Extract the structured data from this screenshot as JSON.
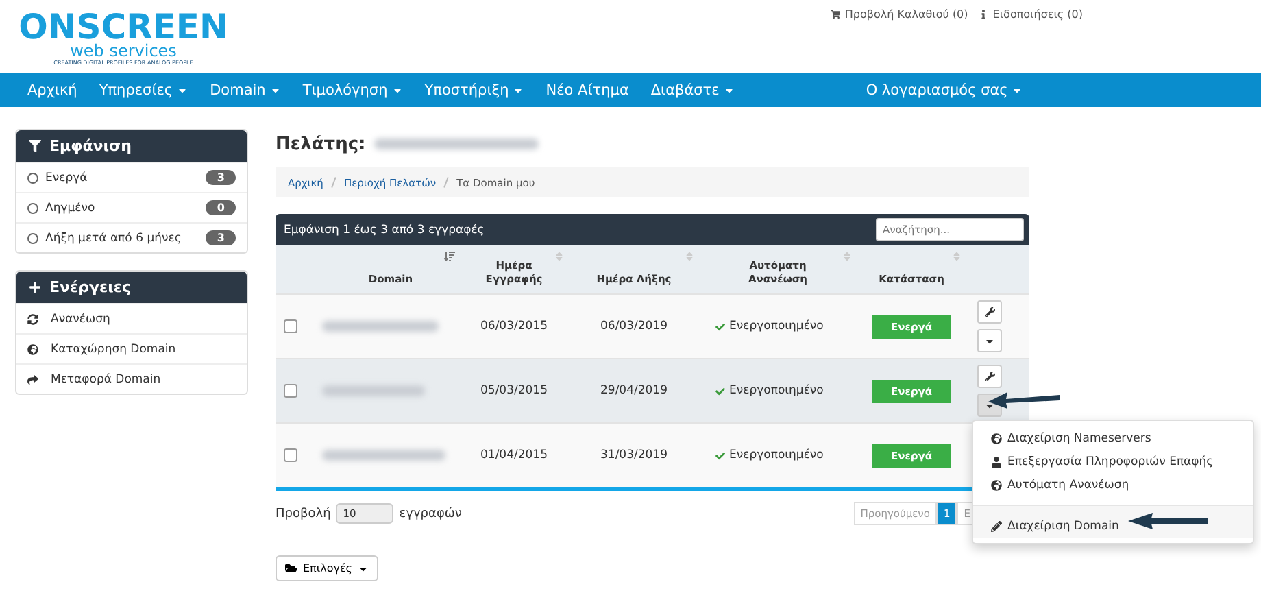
{
  "logo": {
    "title": "ONSCREEN",
    "subtitle": "web services",
    "tagline": "CREATING DIGITAL PROFILES FOR ANALOG PEOPLE"
  },
  "header_links": [
    "Προβολή Καλαθιού (0)",
    "Ειδοποιήσεις (0)"
  ],
  "nav": [
    {
      "label": "Αρχική",
      "dropdown": false
    },
    {
      "label": "Υπηρεσίες",
      "dropdown": true
    },
    {
      "label": "Domain",
      "dropdown": true
    },
    {
      "label": "Τιμολόγηση",
      "dropdown": true
    },
    {
      "label": "Υποστήριξη",
      "dropdown": true
    },
    {
      "label": "Νέο Αίτημα",
      "dropdown": false
    },
    {
      "label": "Διαβάστε",
      "dropdown": true
    }
  ],
  "account": {
    "label": "Ο λογαριασμός σας",
    "dropdown": true
  },
  "sidebar": [
    {
      "title": "Εμφάνιση",
      "kind": "filter",
      "items": [
        {
          "label": "Ενεργά",
          "count": "3",
          "selected": false
        },
        {
          "label": "Ληγμένο",
          "count": "0",
          "selected": false
        },
        {
          "label": "Λήξη μετά από 6 μήνες",
          "count": "3",
          "selected": false
        }
      ]
    },
    {
      "title": "Ενέργειες",
      "kind": "actions",
      "items": [
        {
          "label": "Ανανέωση",
          "kind": "refresh"
        },
        {
          "label": "Καταχώρηση Domain",
          "kind": "globe"
        },
        {
          "label": "Μεταφορά Domain",
          "kind": "share"
        }
      ]
    }
  ],
  "page_title": "Πελάτης:",
  "breadcrumb": [
    {
      "label": "Αρχική",
      "link": true
    },
    {
      "label": "Περιοχή Πελατών",
      "link": true
    },
    {
      "label": "Τα Domain μου",
      "link": false
    }
  ],
  "table": {
    "info": "Εμφάνιση 1 έως 3 από 3 εγγραφές",
    "search": {
      "placeholder": "Αναζήτηση..."
    },
    "columns": [
      {
        "label": "Domain",
        "sorted": true
      },
      {
        "label": "Ημέρα Εγγραφής",
        "sorted": false
      },
      {
        "label": "Ημέρα Λήξης",
        "sorted": false
      },
      {
        "label": "Αυτόματη Ανανέωση",
        "sorted": false
      },
      {
        "label": "Κατάσταση",
        "sorted": false
      }
    ],
    "rows": [
      {
        "checked": false,
        "registered": "06/03/2015",
        "expires": "06/03/2019",
        "auto_renew": "Ενεργοποιημένο",
        "status": "Ενεργά",
        "menu_open": false
      },
      {
        "checked": false,
        "registered": "05/03/2015",
        "expires": "29/04/2019",
        "auto_renew": "Ενεργοποιημένο",
        "status": "Ενεργά",
        "menu_open": true
      },
      {
        "checked": false,
        "registered": "01/04/2015",
        "expires": "31/03/2019",
        "auto_renew": "Ενεργοποιημένο",
        "status": "Ενεργά",
        "menu_open": false
      }
    ]
  },
  "dropdown": {
    "items": [
      {
        "label": "Διαχείριση Nameservers",
        "kind": "globe",
        "divider_before": false
      },
      {
        "label": "Επεξεργασία Πληροφοριών Επαφής",
        "kind": "user",
        "divider_before": false
      },
      {
        "label": "Αυτόματη Ανανέωση",
        "kind": "globe",
        "divider_before": false
      },
      {
        "label": "Διαχείριση Domain",
        "kind": "pencil",
        "divider_before": true
      }
    ]
  },
  "footer": {
    "show_label": "Προβολή",
    "page_size": "10",
    "records_label": "εγγραφών",
    "pagination": [
      {
        "label": "Προηγούμενο",
        "selected": false
      },
      {
        "label": "1",
        "selected": true
      },
      {
        "label": "Ε",
        "selected": false
      }
    ]
  },
  "options_button": "Επιλογές"
}
